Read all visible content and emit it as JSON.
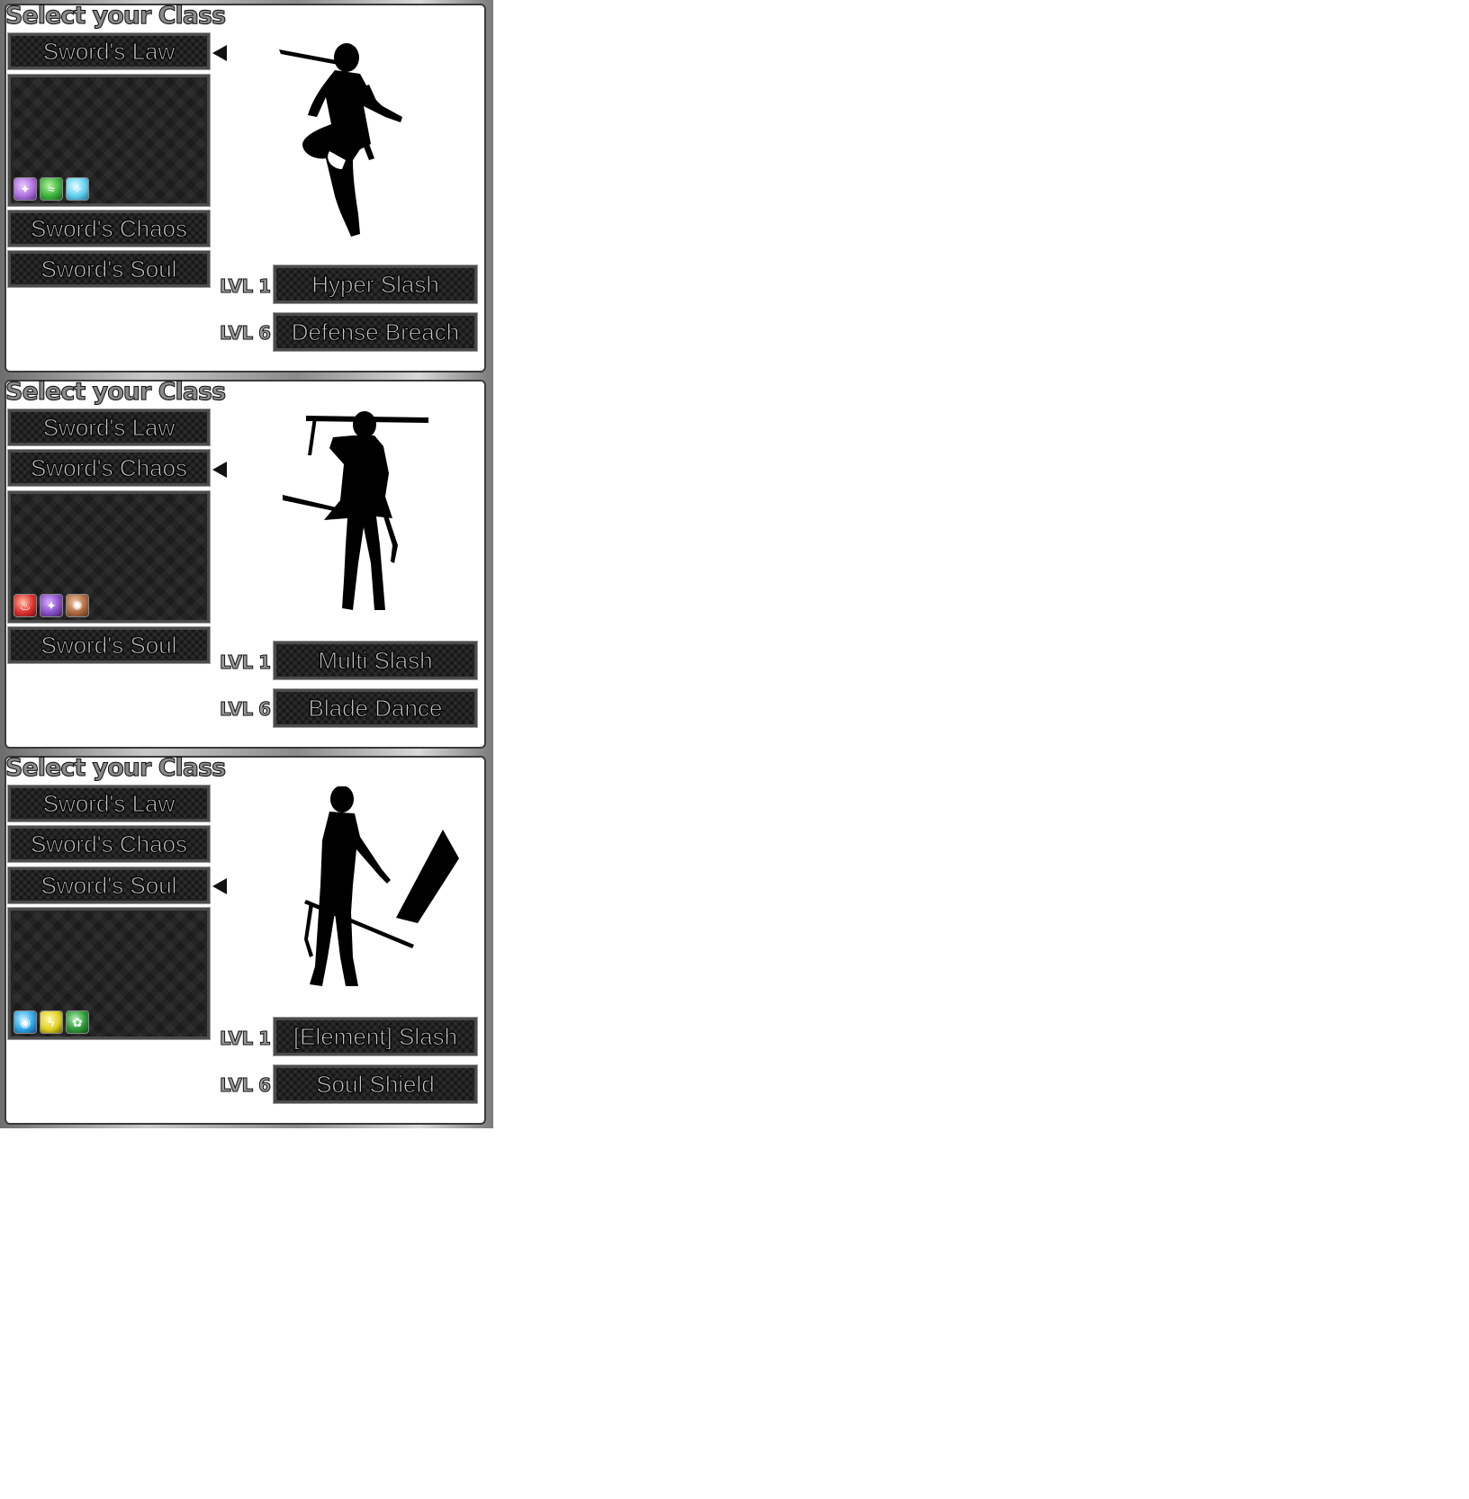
{
  "panels": [
    {
      "title": "Select your Class",
      "selected_class": "Sword's Law",
      "classes": [
        "Sword's Law",
        "Sword's Chaos",
        "Sword's Soul"
      ],
      "orbs": [
        {
          "icon": "purple-orb-icon",
          "color": "#b070e0",
          "glyph": "✦"
        },
        {
          "icon": "green-orb-icon",
          "color": "#3cb43c",
          "glyph": "≈"
        },
        {
          "icon": "cyan-orb-icon",
          "color": "#5fd0f0",
          "glyph": "✧"
        }
      ],
      "skills": [
        {
          "level": "LVL 1",
          "name": "Hyper Slash"
        },
        {
          "level": "LVL 6",
          "name": "Defense Breach"
        }
      ]
    },
    {
      "title": "Select your Class",
      "selected_class": "Sword's Chaos",
      "classes": [
        "Sword's Law",
        "Sword's Chaos",
        "Sword's Soul"
      ],
      "orbs": [
        {
          "icon": "fire-orb-icon",
          "color": "#e03030",
          "glyph": "♨"
        },
        {
          "icon": "purple-orb-icon",
          "color": "#8a50c8",
          "glyph": "✦"
        },
        {
          "icon": "earth-orb-icon",
          "color": "#b06a40",
          "glyph": "✺"
        }
      ],
      "skills": [
        {
          "level": "LVL 1",
          "name": "Multi Slash"
        },
        {
          "level": "LVL 6",
          "name": "Blade Dance"
        }
      ]
    },
    {
      "title": "Select your Class",
      "selected_class": "Sword's Soul",
      "classes": [
        "Sword's Law",
        "Sword's Chaos",
        "Sword's Soul"
      ],
      "orbs": [
        {
          "icon": "water-orb-icon",
          "color": "#30a8e8",
          "glyph": "◉"
        },
        {
          "icon": "lightning-orb-icon",
          "color": "#e0d020",
          "glyph": "ϟ"
        },
        {
          "icon": "nature-orb-icon",
          "color": "#2e9a3a",
          "glyph": "✿"
        }
      ],
      "skills": [
        {
          "level": "LVL 1",
          "name": "[Element] Slash"
        },
        {
          "level": "LVL 6",
          "name": "Soul Shield"
        }
      ]
    }
  ]
}
